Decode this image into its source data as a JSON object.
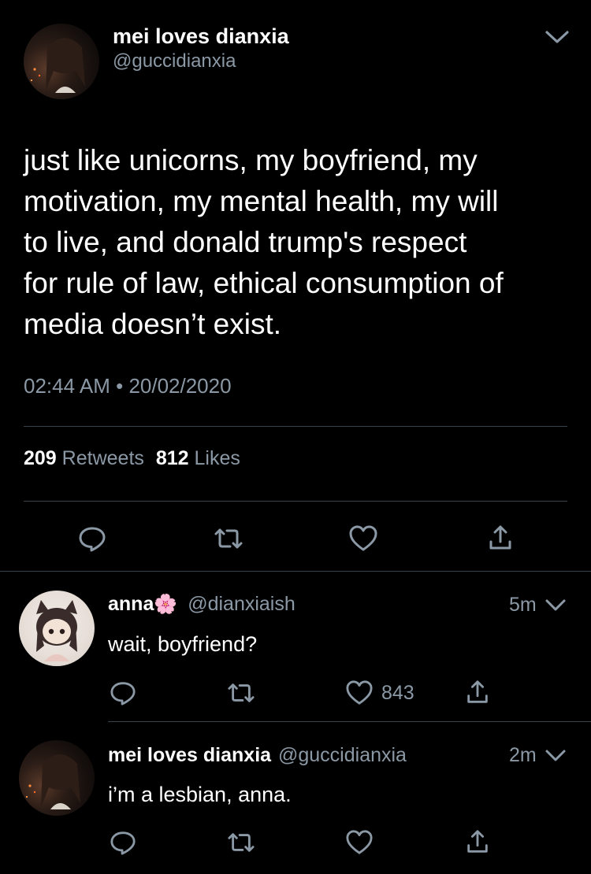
{
  "tweet": {
    "author_name": "mei loves dianxia",
    "author_handle": "@guccidianxia",
    "text_lines": [
      "just like unicorns, my boyfriend, my",
      "motivation, my mental health, my will",
      "to live, and donald trump's respect",
      "for rule of law, ethical consumption of",
      "media doesn’t exist."
    ],
    "time": "02:44 AM",
    "separator": "•",
    "date": "20/02/2020",
    "retweet_count": "209",
    "retweets_label": "Retweets",
    "like_count": "812",
    "likes_label": "Likes"
  },
  "replies": [
    {
      "name": "anna",
      "emoji": "🌸",
      "handle": "@dianxiaish",
      "time": "5m",
      "text": "wait, boyfriend?",
      "like_count": "843"
    },
    {
      "name": "mei loves dianxia",
      "handle": "@guccidianxia",
      "time": "2m",
      "text": "i’m a lesbian, anna."
    }
  ],
  "icons": {
    "reply": "reply-icon",
    "retweet": "retweet-icon",
    "like": "heart-icon",
    "share": "share-icon",
    "menu": "chevron-down-icon"
  },
  "colors": {
    "background": "#000000",
    "text": "#ffffff",
    "muted": "#8b98a5",
    "divider": "#38444d"
  }
}
